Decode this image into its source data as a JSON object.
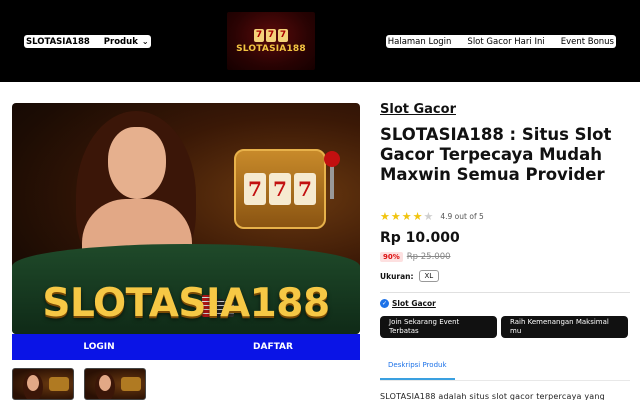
{
  "header": {
    "brand": "SLOTASIA188",
    "produk_label": "Produk",
    "logo_digits": [
      "7",
      "7",
      "7"
    ],
    "logo_text": "SLOTASIA188",
    "nav_links": [
      "Halaman Login",
      "Slot Gacor Hari Ini",
      "Event Bonus"
    ]
  },
  "hero": {
    "reels": [
      "7",
      "7",
      "7"
    ],
    "title": "SLOTASIA188",
    "login_label": "LOGIN",
    "daftar_label": "DAFTAR"
  },
  "product": {
    "category": "Slot Gacor",
    "title": "SLOTASIA188 : Situs Slot Gacor Terpecaya Mudah Maxwin Semua Provider",
    "rating_value": 4.9,
    "rating_text": "4.9 out of 5",
    "price": "Rp 10.000",
    "discount": "90%",
    "old_price": "Rp 25.000",
    "size_label": "Ukuran:",
    "size_option": "XL",
    "badge_label": "Slot Gacor",
    "button_join": "Join Sekarang Event Terbatas",
    "button_win": "Raih Kemenangan Maksimal mu",
    "tab_label": "Deskripsi Produk",
    "description": "SLOTASIA188 adalah situs slot gacor terpercaya yang"
  },
  "colors": {
    "header_bg": "#000000",
    "cta_blue": "#0a14e6",
    "star": "#f1c40f",
    "discount_red": "#d11111",
    "accent_blue": "#1d72e8"
  }
}
